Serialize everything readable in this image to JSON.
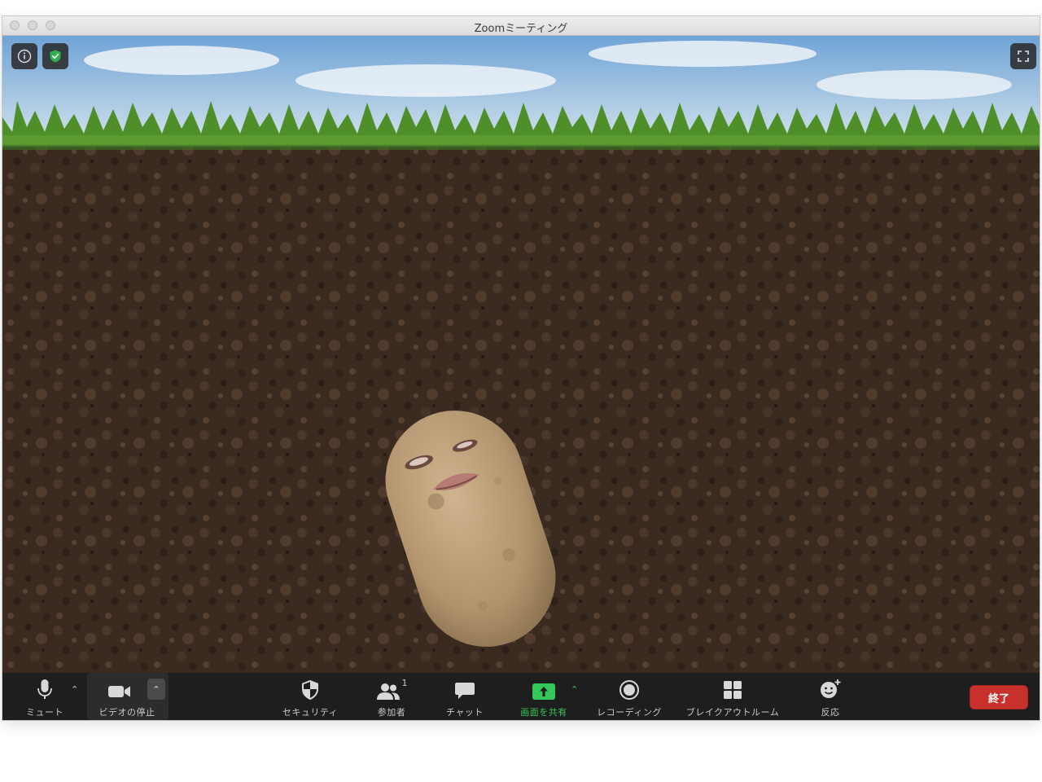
{
  "window": {
    "title": "Zoomミーティング"
  },
  "toolbar": {
    "mute_label": "ミュート",
    "video_label": "ビデオの停止",
    "security_label": "セキュリティ",
    "participants_label": "参加者",
    "participants_count": "1",
    "chat_label": "チャット",
    "share_label": "画面を共有",
    "record_label": "レコーディング",
    "breakout_label": "ブレイクアウトルーム",
    "reactions_label": "反応",
    "end_label": "終了"
  },
  "icons": {
    "info": "info-icon",
    "security_badge": "shield-check-icon",
    "fullscreen": "fullscreen-icon",
    "mic": "microphone-icon",
    "video": "video-camera-icon",
    "security": "shield-icon",
    "participants": "people-icon",
    "chat": "chat-bubble-icon",
    "share": "share-screen-icon",
    "record": "record-icon",
    "breakout": "grid-icon",
    "reactions": "emoji-plus-icon"
  },
  "colors": {
    "share_green": "#34c759",
    "end_red": "#c8302c",
    "toolbar_bg": "#1e1e1e",
    "security_badge_green": "#2fb24c"
  }
}
